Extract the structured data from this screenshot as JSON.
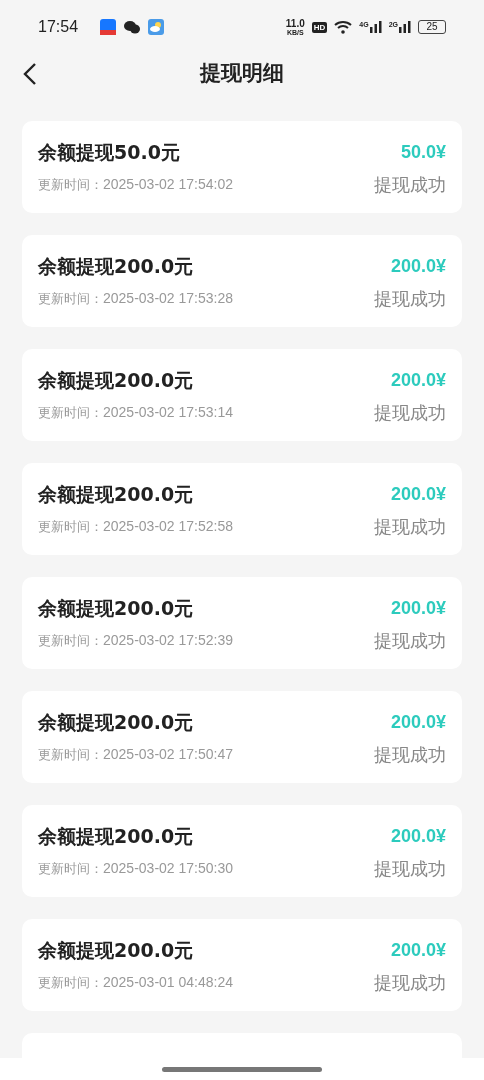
{
  "status_bar": {
    "time": "17:54",
    "speed_value": "11.0",
    "speed_unit": "KB/S",
    "hd": "HD",
    "network_1": "4G",
    "network_2": "2G",
    "battery": "25"
  },
  "header": {
    "title": "提现明细"
  },
  "records": [
    {
      "title": "余额提现50.0元",
      "time_label": "更新时间：",
      "time": "2025-03-02 17:54:02",
      "amount": "50.0¥",
      "status": "提现成功"
    },
    {
      "title": "余额提现200.0元",
      "time_label": "更新时间：",
      "time": "2025-03-02 17:53:28",
      "amount": "200.0¥",
      "status": "提现成功"
    },
    {
      "title": "余额提现200.0元",
      "time_label": "更新时间：",
      "time": "2025-03-02 17:53:14",
      "amount": "200.0¥",
      "status": "提现成功"
    },
    {
      "title": "余额提现200.0元",
      "time_label": "更新时间：",
      "time": "2025-03-02 17:52:58",
      "amount": "200.0¥",
      "status": "提现成功"
    },
    {
      "title": "余额提现200.0元",
      "time_label": "更新时间：",
      "time": "2025-03-02 17:52:39",
      "amount": "200.0¥",
      "status": "提现成功"
    },
    {
      "title": "余额提现200.0元",
      "time_label": "更新时间：",
      "time": "2025-03-02 17:50:47",
      "amount": "200.0¥",
      "status": "提现成功"
    },
    {
      "title": "余额提现200.0元",
      "time_label": "更新时间：",
      "time": "2025-03-02 17:50:30",
      "amount": "200.0¥",
      "status": "提现成功"
    },
    {
      "title": "余额提现200.0元",
      "time_label": "更新时间：",
      "time": "2025-03-01 04:48:24",
      "amount": "200.0¥",
      "status": "提现成功"
    }
  ]
}
